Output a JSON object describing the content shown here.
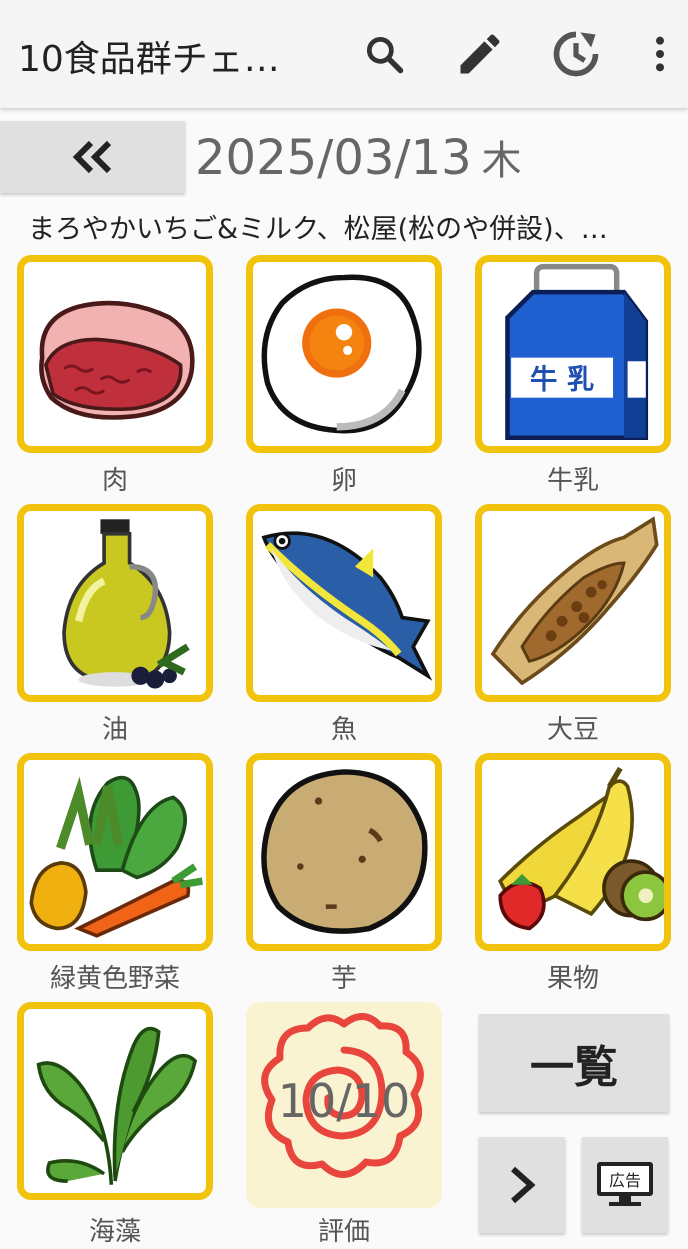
{
  "app": {
    "title": "10食品群チェ…"
  },
  "toolbar": {
    "search_icon": "search-icon",
    "edit_icon": "pencil-icon",
    "history_icon": "history-icon",
    "menu_icon": "more-vert-icon"
  },
  "nav": {
    "back_icon": "double-chevron-left-icon"
  },
  "date": {
    "text": "2025/03/13",
    "weekday": "木"
  },
  "summary": "まろやかいちご&ミルク、松屋(松のや併設)、…",
  "food_groups": [
    {
      "label": "肉",
      "icon": "meat-icon"
    },
    {
      "label": "卵",
      "icon": "egg-icon"
    },
    {
      "label": "牛乳",
      "icon": "milk-carton-icon",
      "carton_text": "牛 乳"
    },
    {
      "label": "油",
      "icon": "oil-bottle-icon"
    },
    {
      "label": "魚",
      "icon": "fish-icon"
    },
    {
      "label": "大豆",
      "icon": "natto-icon"
    },
    {
      "label": "緑黄色野菜",
      "icon": "vegetables-icon"
    },
    {
      "label": "芋",
      "icon": "potato-icon"
    },
    {
      "label": "果物",
      "icon": "fruits-icon"
    },
    {
      "label": "海藻",
      "icon": "seaweed-icon"
    }
  ],
  "evaluation": {
    "label": "評価",
    "score": "10/10",
    "icon": "hanamaru-icon"
  },
  "buttons": {
    "list_label": "一覧",
    "next_icon": "chevron-right-icon",
    "ad_label": "広告"
  },
  "colors": {
    "tile_border": "#f2c30c",
    "button_bg": "#e0e0e0",
    "eval_bg": "#faf3d2",
    "hanamaru": "#e8453c"
  }
}
